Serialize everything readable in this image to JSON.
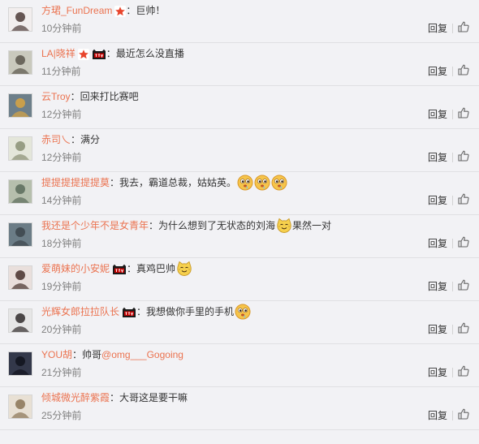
{
  "actions": {
    "reply_label": "回复"
  },
  "colors": {
    "username": "#eb7350",
    "text": "#333333",
    "time": "#808080",
    "background": "#f2f2f5",
    "divider": "#e0e0e3"
  },
  "comments": [
    {
      "username": "方珺_FunDream",
      "badges": [
        "star-icon"
      ],
      "text": "巨帅！",
      "time": "10分钟前",
      "avatar_colors": [
        "#f2eeee",
        "#4d3b37"
      ]
    },
    {
      "username": "LA|晓祥",
      "badges": [
        "star-icon",
        "tmall-vip-icon"
      ],
      "text": "最近怎么没直播",
      "time": "11分钟前",
      "avatar_colors": [
        "#c9c9bd",
        "#5a564c"
      ]
    },
    {
      "username": "云Troy",
      "badges": [],
      "text": "回来打比赛吧",
      "time": "12分钟前",
      "avatar_colors": [
        "#6d7f8a",
        "#d9a441"
      ]
    },
    {
      "username": "赤司乀",
      "badges": [],
      "text": "满分",
      "time": "12分钟前",
      "avatar_colors": [
        "#e4e6da",
        "#8a8f74"
      ]
    },
    {
      "username": "提提提提提提莫",
      "badges": [],
      "text": "我去，霸道总裁，姑姑英。",
      "emoticons": [
        "drool-face-icon",
        "drool-face-icon",
        "drool-face-icon"
      ],
      "time": "14分钟前",
      "avatar_colors": [
        "#b6bfad",
        "#5b6b5a"
      ]
    },
    {
      "username": "我还是个少年不是女青年",
      "badges": [],
      "text": "为什么想到了无状态的刘海",
      "emoticons": [
        "cat-face-icon"
      ],
      "text_after": "果然一对",
      "time": "18分钟前",
      "avatar_colors": [
        "#6b7c86",
        "#3c454b"
      ]
    },
    {
      "username": "爱萌妹的小安妮",
      "badges": [
        "tmall-vip-icon"
      ],
      "text": "真鸡巴帅",
      "emoticons": [
        "cat-face-icon"
      ],
      "time": "19分钟前",
      "avatar_colors": [
        "#e9dfdc",
        "#46302b"
      ]
    },
    {
      "username": "光辉女郎拉拉队长",
      "badges": [
        "tmall-vip-icon"
      ],
      "text": "我想做你手里的手机",
      "emoticons": [
        "drool-face-icon"
      ],
      "time": "20分钟前",
      "avatar_colors": [
        "#e6e6e6",
        "#2f2a2a"
      ]
    },
    {
      "username": "YOU胡",
      "badges": [],
      "text": "帅哥",
      "mention": "@omg___Gogoing",
      "time": "21分钟前",
      "avatar_colors": [
        "#33384a",
        "#11131c"
      ]
    },
    {
      "username": "倾城微光醉紫霞",
      "badges": [],
      "text": "大哥这是要干嘛",
      "time": "25分钟前",
      "avatar_colors": [
        "#e8e0d4",
        "#8a7355"
      ]
    }
  ]
}
